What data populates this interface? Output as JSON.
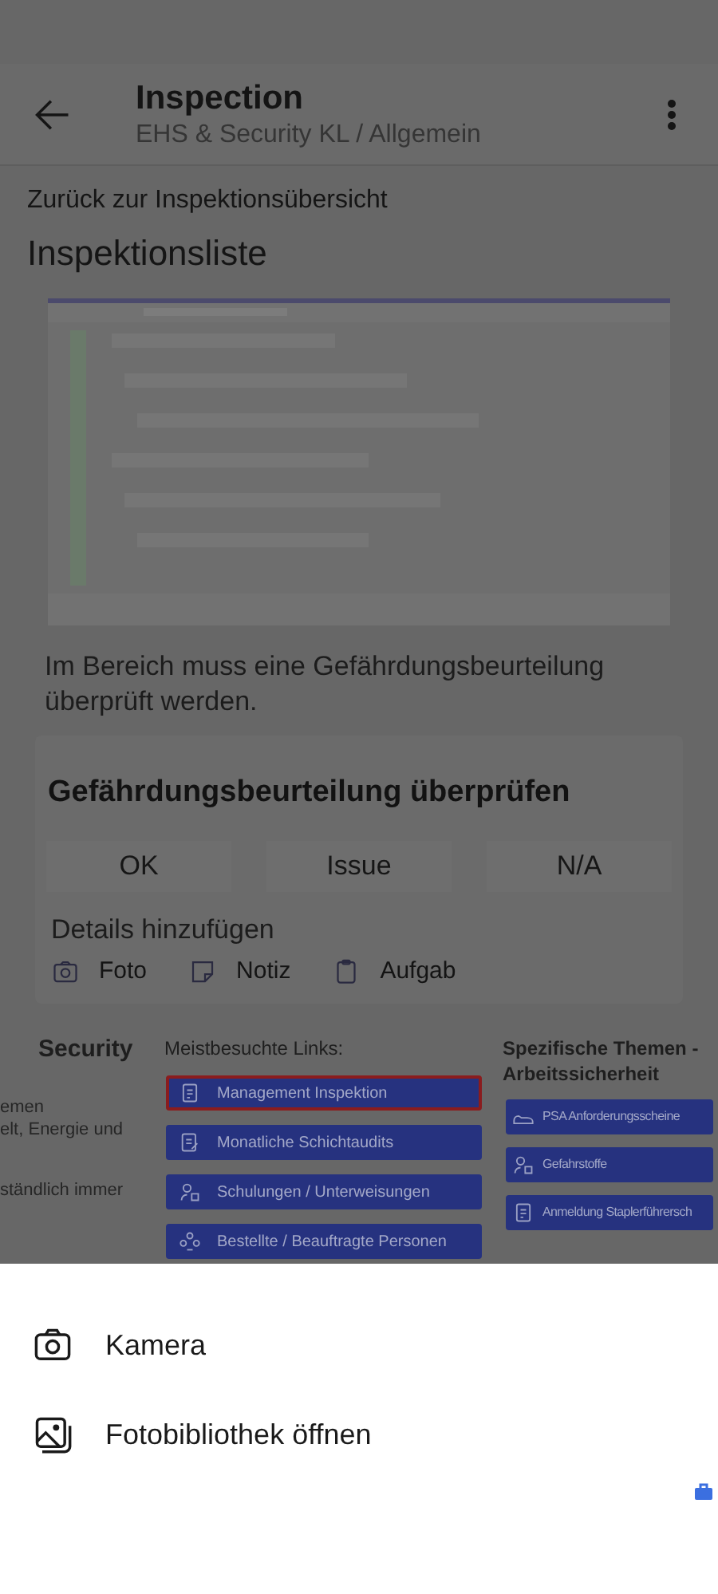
{
  "app_bar": {
    "title": "Inspection",
    "subtitle": "EHS & Security KL / Allgemein"
  },
  "back_link": "Zurück zur Inspektionsübersicht",
  "page_title": "Inspektionsliste",
  "question": {
    "description": "Im Bereich muss eine Gefährdungsbeurteilung überprüft werden.",
    "title": "Gefährdungsbeurteilung überprüfen",
    "answers": [
      {
        "label": "OK",
        "selected": false
      },
      {
        "label": "Issue",
        "selected": false
      },
      {
        "label": "N/A",
        "selected": false
      }
    ],
    "details_label": "Details hinzufügen",
    "detail_actions": [
      {
        "label": "Foto"
      },
      {
        "kind": "note",
        "label": "Notiz"
      },
      {
        "kind": "task",
        "label": "Aufgab"
      }
    ]
  },
  "intranet": {
    "column_1": {
      "heading": "Security",
      "lines": [
        "emen",
        "elt, Energie und",
        "ständlich immer"
      ]
    },
    "links": {
      "heading": "Meistbesuchte Links:",
      "items": [
        {
          "kind": "document",
          "label": "Management Inspektion",
          "highlighted": true
        },
        {
          "kind": "checklist",
          "label": "Monatliche Schichtaudits",
          "highlighted": false
        },
        {
          "kind": "people",
          "label": "Schulungen / Unterweisungen",
          "highlighted": false
        },
        {
          "kind": "group",
          "label": "Bestellte / Beauftragte Personen",
          "highlighted": false
        }
      ]
    },
    "topics": {
      "heading": "Spezifische Themen - Arbeitssicherheit",
      "items": [
        {
          "kind": "shoe",
          "label": "PSA Anforderungsscheine"
        },
        {
          "kind": "people",
          "label": "Gefahrstoffe"
        },
        {
          "kind": "document",
          "label": "Anmeldung Staplerführersch"
        }
      ]
    }
  },
  "sheet": {
    "options": [
      {
        "kind": "camera",
        "label": "Kamera"
      },
      {
        "kind": "gallery",
        "label": "Fotobibliothek öffnen"
      }
    ]
  }
}
